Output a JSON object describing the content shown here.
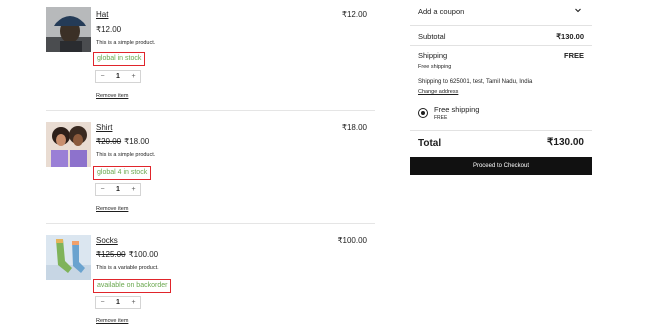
{
  "cart_items": [
    {
      "name": "Hat",
      "old_price": "",
      "price": "₹12.00",
      "description": "This is a simple product.",
      "stock_status": "global in stock",
      "quantity": "1",
      "minus": "−",
      "plus": "+",
      "remove_label": "Remove item",
      "line_total": "₹12.00"
    },
    {
      "name": "Shirt",
      "old_price": "₹20.00",
      "price": "₹18.00",
      "description": "This is a simple product.",
      "stock_status": "global 4 in stock",
      "quantity": "1",
      "minus": "−",
      "plus": "+",
      "remove_label": "Remove item",
      "line_total": "₹18.00"
    },
    {
      "name": "Socks",
      "old_price": "₹125.00",
      "price": "₹100.00",
      "description": "This is a variable product.",
      "stock_status": "available on backorder",
      "quantity": "1",
      "minus": "−",
      "plus": "+",
      "remove_label": "Remove item",
      "line_total": "₹100.00"
    }
  ],
  "summary": {
    "coupon_label": "Add a coupon",
    "subtotal_label": "Subtotal",
    "subtotal_value": "₹130.00",
    "shipping_label": "Shipping",
    "shipping_value": "FREE",
    "shipping_method_note": "Free shipping",
    "shipping_address": "Shipping to 625001, test, Tamil Nadu, India",
    "change_address_label": "Change address",
    "option_label": "Free shipping",
    "option_price": "FREE",
    "total_label": "Total",
    "total_value": "₹130.00",
    "checkout_label": "Proceed to Checkout"
  },
  "colors": {
    "stock_text": "#6aa84f",
    "highlight_border": "#e0252b",
    "checkout_bg": "#111111"
  }
}
